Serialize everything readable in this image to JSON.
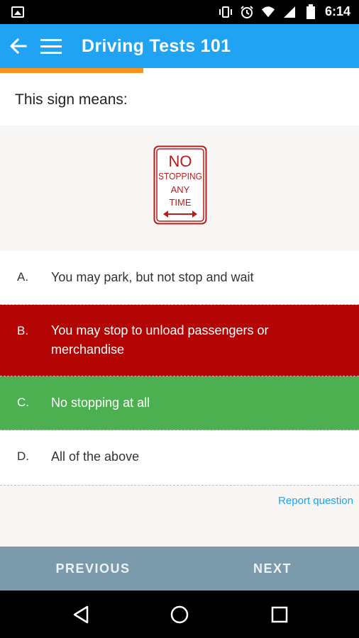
{
  "status_bar": {
    "time": "6:14",
    "icons": [
      "gallery-icon",
      "vibrate-icon",
      "alarm-icon",
      "wifi-icon",
      "signal-icon",
      "battery-icon"
    ]
  },
  "app_bar": {
    "title": "Driving Tests 101",
    "color": "#1fa3f2",
    "icons": [
      "back-arrow-icon",
      "hamburger-menu-icon"
    ]
  },
  "progress": {
    "fraction": 0.4,
    "color": "#f7931e"
  },
  "question": {
    "prompt": "This sign means:",
    "sign": {
      "line1": "NO",
      "line2": "STOPPING",
      "line3": "ANY",
      "line4": "TIME",
      "color": "#b71c1c"
    }
  },
  "answers": [
    {
      "letter": "A.",
      "text": "You may park, but not stop and wait",
      "state": "default"
    },
    {
      "letter": "B.",
      "text": "You may stop to unload passengers or merchandise",
      "state": "incorrect",
      "color": "#b40505"
    },
    {
      "letter": "C.",
      "text": "No stopping at all",
      "state": "correct",
      "color": "#4caf50"
    },
    {
      "letter": "D.",
      "text": "All of the above",
      "state": "default"
    }
  ],
  "report_link": "Report question",
  "bottom_nav": {
    "previous": "PREVIOUS",
    "next": "NEXT"
  },
  "system_nav": {
    "icons": [
      "back-triangle-icon",
      "home-circle-icon",
      "recents-square-icon"
    ]
  }
}
